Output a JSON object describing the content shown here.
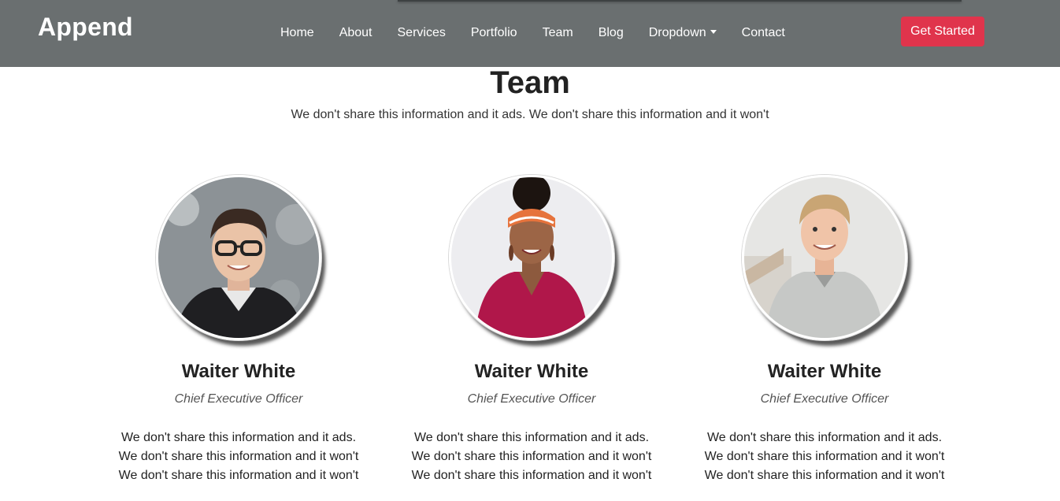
{
  "brand": {
    "name": "Append"
  },
  "nav": {
    "items": [
      "Home",
      "About",
      "Services",
      "Portfolio",
      "Team",
      "Blog",
      "Dropdown",
      "Contact"
    ],
    "cta_label": "Get Started"
  },
  "team": {
    "title": "Team",
    "subtitle": "We don't share this information and it ads. We don't share this information and it won't",
    "members": [
      {
        "name": "Waiter White",
        "role": "Chief Executive Officer",
        "bio": "We don't share this information and it ads. We don't share this information and it won't We don't share this information and it won't"
      },
      {
        "name": "Waiter White",
        "role": "Chief Executive Officer",
        "bio": "We don't share this information and it ads. We don't share this information and it won't We don't share this information and it won't"
      },
      {
        "name": "Waiter White",
        "role": "Chief Executive Officer",
        "bio": "We don't share this information and it ads. We don't share this information and it won't We don't share this information and it won't"
      }
    ]
  },
  "colors": {
    "navbar": "#6a6f70",
    "accent": "#e0344c"
  }
}
